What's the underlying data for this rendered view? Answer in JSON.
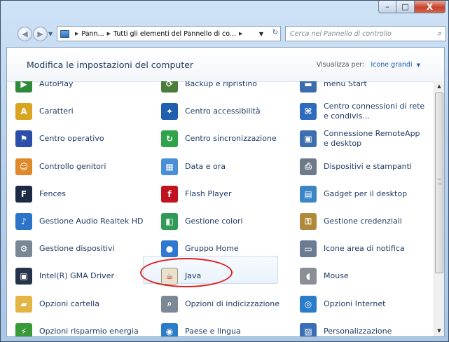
{
  "window": {
    "min_glyph": "–",
    "max_glyph": "□",
    "close_glyph": "X"
  },
  "nav": {
    "back_glyph": "◀",
    "forward_glyph": "▶",
    "dropdown_glyph": "▼",
    "breadcrumb": [
      "Pann...",
      "Tutti gli elementi del Pannello di co..."
    ],
    "breadcrumb_sep": "▶",
    "address_dropdown_glyph": "▼",
    "refresh_glyph": "↻",
    "search_placeholder": "Cerca nel Pannello di controllo",
    "search_glyph": "⌕"
  },
  "header": {
    "title": "Modifica le impostazioni del computer",
    "view_by_label": "Visualizza per:",
    "view_by_value": "Icone grandi",
    "view_by_arrow": "▼"
  },
  "items": [
    {
      "label": "AutoPlay",
      "icon": "autoplay-icon",
      "color": "#2d8a3a",
      "glyph": "▶"
    },
    {
      "label": "Backup e ripristino",
      "icon": "backup-icon",
      "color": "#4a7c3a",
      "glyph": "⟳"
    },
    {
      "label": "menu Start",
      "icon": "taskbar-icon",
      "color": "#3b6cb0",
      "glyph": "▬"
    },
    {
      "label": "Caratteri",
      "icon": "fonts-icon",
      "color": "#d9a520",
      "glyph": "A"
    },
    {
      "label": "Centro accessibilità",
      "icon": "accessibility-icon",
      "color": "#1f5fb0",
      "glyph": "✦"
    },
    {
      "label": "Centro connessioni di rete e condivis...",
      "icon": "network-icon",
      "color": "#2e6bbf",
      "glyph": "⌘"
    },
    {
      "label": "Centro operativo",
      "icon": "flag-icon",
      "color": "#2b4fa8",
      "glyph": "⚑"
    },
    {
      "label": "Centro sincronizzazione",
      "icon": "sync-icon",
      "color": "#2fa34a",
      "glyph": "↻"
    },
    {
      "label": "Connessione RemoteApp e desktop",
      "icon": "remoteapp-icon",
      "color": "#3d6fae",
      "glyph": "▣"
    },
    {
      "label": "Controllo genitori",
      "icon": "parental-icon",
      "color": "#e0892a",
      "glyph": "☺"
    },
    {
      "label": "Data e ora",
      "icon": "calendar-icon",
      "color": "#4a8fd6",
      "glyph": "▦"
    },
    {
      "label": "Dispositivi e stampanti",
      "icon": "printer-icon",
      "color": "#6c7a89",
      "glyph": "⎙"
    },
    {
      "label": "Fences",
      "icon": "fences-icon",
      "color": "#1c2a44",
      "glyph": "F"
    },
    {
      "label": "Flash Player",
      "icon": "flash-icon",
      "color": "#c1121f",
      "glyph": "f"
    },
    {
      "label": "Gadget per il desktop",
      "icon": "gadget-icon",
      "color": "#3d86c6",
      "glyph": "▤"
    },
    {
      "label": "Gestione Audio Realtek HD",
      "icon": "audio-icon",
      "color": "#2c74c9",
      "glyph": "♪"
    },
    {
      "label": "Gestione colori",
      "icon": "color-management-icon",
      "color": "#2f9b57",
      "glyph": "◧"
    },
    {
      "label": "Gestione credenziali",
      "icon": "credentials-icon",
      "color": "#b08a3a",
      "glyph": "⚿"
    },
    {
      "label": "Gestione dispositivi",
      "icon": "device-manager-icon",
      "color": "#7a8796",
      "glyph": "⚙"
    },
    {
      "label": "Gruppo Home",
      "icon": "homegroup-icon",
      "color": "#2f78d0",
      "glyph": "●"
    },
    {
      "label": "Icone area di notifica",
      "icon": "notification-area-icon",
      "color": "#6b7c92",
      "glyph": "▭"
    },
    {
      "label": "Intel(R) GMA Driver",
      "icon": "intel-icon",
      "color": "#25344a",
      "glyph": "▣"
    },
    {
      "label": "Java",
      "icon": "java-icon",
      "color": "#e8e2cf",
      "glyph": "☕"
    },
    {
      "label": "Mouse",
      "icon": "mouse-icon",
      "color": "#8a8f96",
      "glyph": "◖"
    },
    {
      "label": "Opzioni cartella",
      "icon": "folder-options-icon",
      "color": "#e2b545",
      "glyph": "▰"
    },
    {
      "label": "Opzioni di indicizzazione",
      "icon": "indexing-icon",
      "color": "#7b8896",
      "glyph": "⌕"
    },
    {
      "label": "Opzioni Internet",
      "icon": "internet-options-icon",
      "color": "#2b7cc9",
      "glyph": "◎"
    },
    {
      "label": "Opzioni risparmio energia",
      "icon": "power-icon",
      "color": "#3a9a3a",
      "glyph": "⚡"
    },
    {
      "label": "Paese e lingua",
      "icon": "region-icon",
      "color": "#2b7cc9",
      "glyph": "◉"
    },
    {
      "label": "Personalizzazione",
      "icon": "personalization-icon",
      "color": "#3a6fb5",
      "glyph": "▨"
    }
  ],
  "scrollbar": {
    "up_glyph": "▲",
    "down_glyph": "▼"
  }
}
